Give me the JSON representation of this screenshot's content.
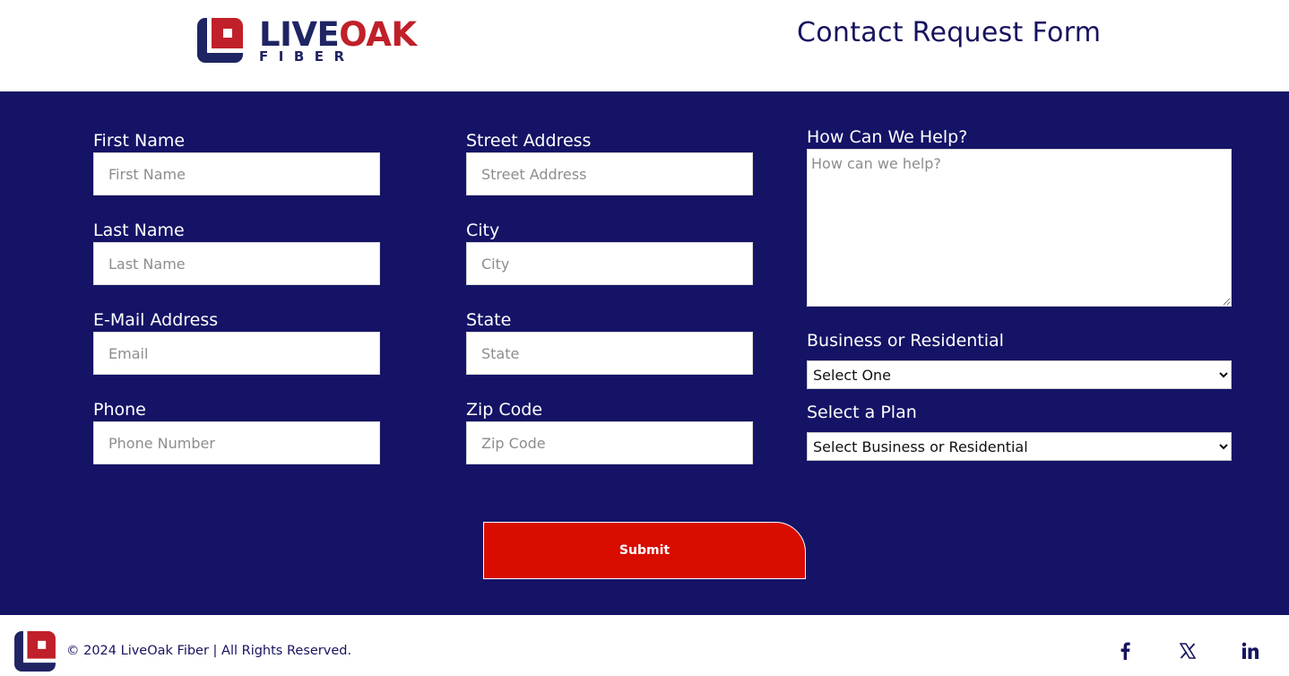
{
  "brand": {
    "word_primary": "LIVE",
    "word_accent": "OAK",
    "subline": "FIBER",
    "primary_color": "#1f2463",
    "accent_color": "#c0202a"
  },
  "header": {
    "title": "Contact Request Form"
  },
  "form": {
    "background_color": "#151366",
    "first_name": {
      "label": "First Name",
      "placeholder": "First Name",
      "value": ""
    },
    "last_name": {
      "label": "Last Name",
      "placeholder": "Last Name",
      "value": ""
    },
    "email": {
      "label": "E-Mail Address",
      "placeholder": "Email",
      "value": ""
    },
    "phone": {
      "label": "Phone",
      "placeholder": "Phone Number",
      "value": ""
    },
    "street": {
      "label": "Street Address",
      "placeholder": "Street Address",
      "value": ""
    },
    "city": {
      "label": "City",
      "placeholder": "City",
      "value": ""
    },
    "state": {
      "label": "State",
      "placeholder": "State",
      "value": ""
    },
    "zip": {
      "label": "Zip Code",
      "placeholder": "Zip Code",
      "value": ""
    },
    "help": {
      "label": "How Can We Help?",
      "placeholder": "How can we help?",
      "value": ""
    },
    "customer_type": {
      "label": "Business or Residential",
      "selected": "Select One"
    },
    "plan": {
      "label": "Select a Plan",
      "selected": "Select Business or Residential"
    },
    "submit_label": "Submit",
    "submit_color": "#d90c00"
  },
  "footer": {
    "copyright": "© 2024 LiveOak Fiber | All Rights Reserved.",
    "social": [
      "facebook-icon",
      "x-icon",
      "linkedin-icon"
    ]
  }
}
